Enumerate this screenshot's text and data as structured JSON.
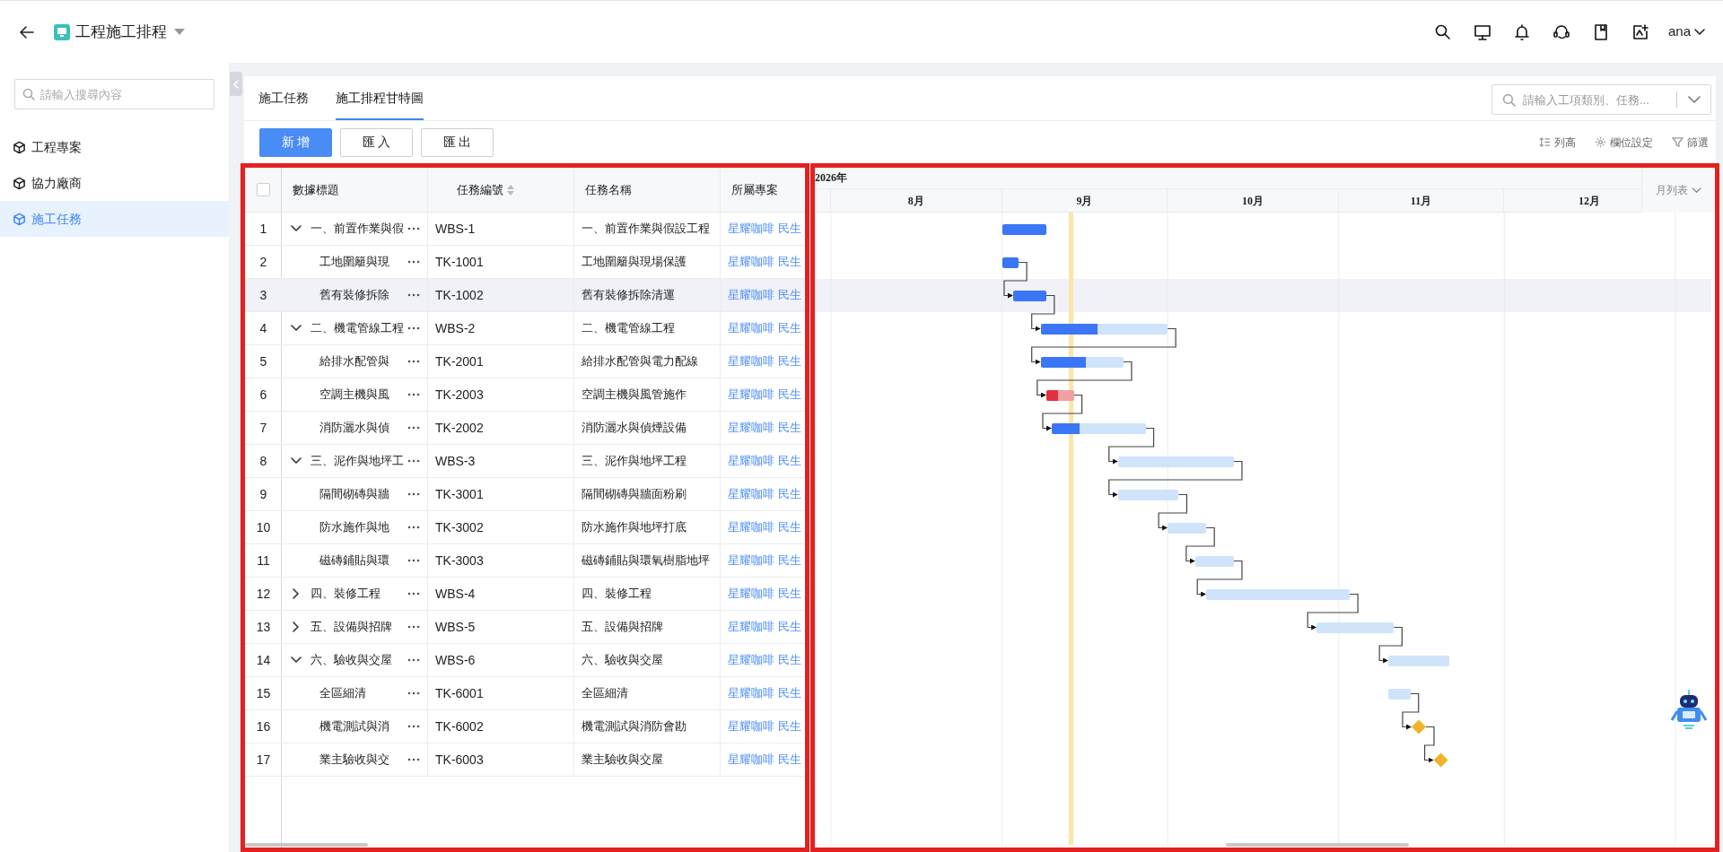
{
  "app": {
    "title": "工程施工排程"
  },
  "user": {
    "name": "ana"
  },
  "sidebar": {
    "search_placeholder": "請輸入搜尋內容",
    "items": [
      {
        "label": "工程專案",
        "selected": false
      },
      {
        "label": "協力廠商",
        "selected": false
      },
      {
        "label": "施工任務",
        "selected": true
      }
    ]
  },
  "tabs": [
    {
      "label": "施工任務",
      "selected": false
    },
    {
      "label": "施工排程甘特圖",
      "selected": true
    }
  ],
  "search": {
    "placeholder": "請輸入工項類別、任務..."
  },
  "buttons": [
    {
      "label": "新 增",
      "kind": "primary"
    },
    {
      "label": "匯 入",
      "kind": "default"
    },
    {
      "label": "匯 出",
      "kind": "default"
    }
  ],
  "view_actions": [
    {
      "label": "列高",
      "kind": "row_height"
    },
    {
      "label": "欄位設定",
      "kind": "columns"
    },
    {
      "label": "篩選",
      "kind": "filter"
    }
  ],
  "table": {
    "select_all": {
      "checked": false
    },
    "columns": [
      {
        "label": "數據標題",
        "sortable": false
      },
      {
        "label": "任務編號",
        "sortable": true
      },
      {
        "label": "任務名稱",
        "sortable": false
      },
      {
        "label": "所屬專案",
        "sortable": false
      }
    ],
    "rows": [
      {
        "index": "1",
        "title": "一、前置作業與假",
        "code": "WBS-1",
        "name": "一、前置作業與假設工程",
        "project": "星耀咖啡 民生",
        "highlighted": false,
        "expanded": true,
        "bar": {
          "kind": "bar",
          "level": 1
        },
        "children": [
          {
            "index": "2",
            "title": "工地圍籬與現",
            "code": "TK-1001",
            "name": "工地圍籬與現場保護",
            "project": "星耀咖啡 民生",
            "highlighted": false,
            "bar": {
              "kind": "bar",
              "level": 1
            }
          },
          {
            "index": "3",
            "title": "舊有裝修拆除",
            "code": "TK-1002",
            "name": "舊有裝修拆除清運",
            "project": "星耀咖啡 民生",
            "highlighted": true,
            "bar": {
              "kind": "bar",
              "level": 1
            }
          }
        ]
      },
      {
        "index": "4",
        "title": "二、機電管線工程",
        "code": "WBS-2",
        "name": "二、機電管線工程",
        "project": "星耀咖啡 民生",
        "highlighted": false,
        "expanded": true,
        "bar": {
          "kind": "bar",
          "level": 0.45
        },
        "children": [
          {
            "index": "5",
            "title": "給排水配管與",
            "code": "TK-2001",
            "name": "給排水配管與電力配線",
            "project": "星耀咖啡 民生",
            "highlighted": false,
            "bar": {
              "kind": "bar",
              "level": 0.55
            }
          },
          {
            "index": "6",
            "title": "空調主機與風",
            "code": "TK-2003",
            "name": "空調主機與風管施作",
            "project": "星耀咖啡 民生",
            "highlighted": false,
            "bar": {
              "kind": "overdue",
              "level": 0.42
            }
          },
          {
            "index": "7",
            "title": "消防灑水與偵",
            "code": "TK-2002",
            "name": "消防灑水與偵煙設備",
            "project": "星耀咖啡 民生",
            "highlighted": false,
            "bar": {
              "kind": "bar",
              "level": 0.3
            }
          }
        ]
      },
      {
        "index": "8",
        "title": "三、泥作與地坪工",
        "code": "WBS-3",
        "name": "三、泥作與地坪工程",
        "project": "星耀咖啡 民生",
        "highlighted": false,
        "expanded": true,
        "bar": {
          "kind": "bar"
        },
        "children": [
          {
            "index": "9",
            "title": "隔間砌磚與牆",
            "code": "TK-3001",
            "name": "隔間砌磚與牆面粉刷",
            "project": "星耀咖啡 民生",
            "highlighted": false,
            "bar": {
              "kind": "bar"
            }
          },
          {
            "index": "10",
            "title": "防水施作與地",
            "code": "TK-3002",
            "name": "防水施作與地坪打底",
            "project": "星耀咖啡 民生",
            "highlighted": false,
            "bar": {
              "kind": "bar"
            }
          },
          {
            "index": "11",
            "title": "磁磚鋪貼與環",
            "code": "TK-3003",
            "name": "磁磚鋪貼與環氧樹脂地坪",
            "project": "星耀咖啡 民生",
            "highlighted": false,
            "bar": {
              "kind": "bar"
            }
          }
        ]
      },
      {
        "index": "12",
        "title": "四、裝修工程",
        "code": "WBS-4",
        "name": "四、裝修工程",
        "project": "星耀咖啡 民生",
        "highlighted": false,
        "expanded": false,
        "bar": {
          "kind": "bar"
        }
      },
      {
        "index": "13",
        "title": "五、設備與招牌",
        "code": "WBS-5",
        "name": "五、設備與招牌",
        "project": "星耀咖啡 民生",
        "highlighted": false,
        "expanded": false,
        "bar": {
          "kind": "bar"
        }
      },
      {
        "index": "14",
        "title": "六、驗收與交屋",
        "code": "WBS-6",
        "name": "六、驗收與交屋",
        "project": "星耀咖啡 民生",
        "highlighted": false,
        "expanded": true,
        "bar": {
          "kind": "bar"
        },
        "children": [
          {
            "index": "15",
            "title": "全區細清",
            "code": "TK-6001",
            "name": "全區細清",
            "project": "星耀咖啡 民生",
            "highlighted": false,
            "bar": {
              "kind": "bar"
            }
          },
          {
            "index": "16",
            "title": "機電測試與消",
            "code": "TK-6002",
            "name": "機電測試與消防會勘",
            "project": "星耀咖啡 民生",
            "highlighted": false,
            "bar": {
              "kind": "milestone"
            }
          },
          {
            "index": "17",
            "title": "業主驗收與交",
            "code": "TK-6003",
            "name": "業主驗收與交屋",
            "project": "星耀咖啡 民生",
            "highlighted": false,
            "bar": {
              "kind": "milestone"
            }
          }
        ]
      }
    ]
  },
  "gantt": {
    "year": "2026年",
    "view": "月列表",
    "months": [
      "8月",
      "9月",
      "10月",
      "11月",
      "12月"
    ]
  }
}
